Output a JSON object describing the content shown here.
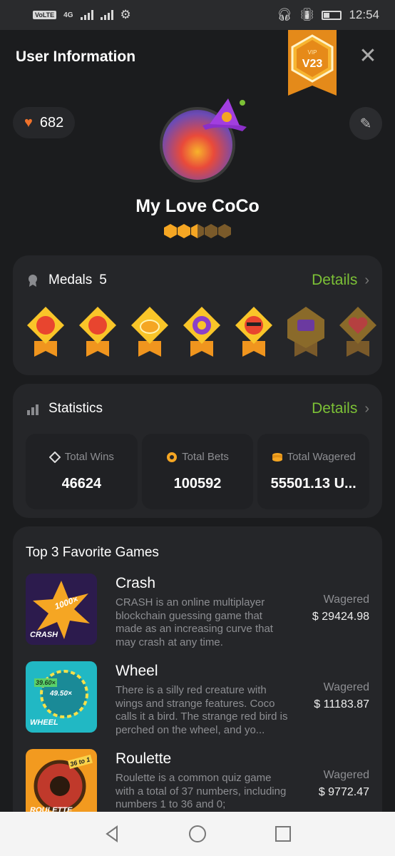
{
  "status_bar": {
    "time": "12:54",
    "volte": "VoLTE",
    "network": "4G"
  },
  "header": {
    "title": "User Information",
    "vip_label": "VIP",
    "vip_level": "V23"
  },
  "profile": {
    "likes": "682",
    "username": "My Love CoCo",
    "rank_filled": 2.5,
    "rank_total": 5
  },
  "medals": {
    "title": "Medals",
    "count": "5",
    "details_label": "Details",
    "items": [
      "medal-1",
      "medal-2",
      "medal-3",
      "medal-4",
      "medal-5",
      "medal-6-locked",
      "medal-7-locked"
    ]
  },
  "statistics": {
    "title": "Statistics",
    "details_label": "Details",
    "items": [
      {
        "label": "Total Wins",
        "value": "46624"
      },
      {
        "label": "Total Bets",
        "value": "100592"
      },
      {
        "label": "Total Wagered",
        "value": "55501.13 U..."
      }
    ]
  },
  "games": {
    "title": "Top 3 Favorite Games",
    "items": [
      {
        "name": "Crash",
        "thumb_tag": "CRASH",
        "thumb_badge": "1000×",
        "wager_label": "Wagered",
        "wager": "$ 29424.98",
        "desc": "CRASH is an online multiplayer blockchain guessing game that made as an increasing curve that may crash at any time."
      },
      {
        "name": "Wheel",
        "thumb_tag": "WHEEL",
        "thumb_badge": "49.50×",
        "thumb_badge2": "39.60×",
        "wager_label": "Wagered",
        "wager": "$ 11183.87",
        "desc": "There is a silly red creature with wings and strange features. Coco calls it a bird. The strange red bird is perched on the wheel, and yo..."
      },
      {
        "name": "Roulette",
        "thumb_tag": "ROULETTE",
        "thumb_badge": "36 to 1",
        "wager_label": "Wagered",
        "wager": "$ 9772.47",
        "desc": "Roulette is a common quiz game with a total of 37 numbers, including numbers 1 to 36 and 0;"
      }
    ]
  },
  "colors": {
    "accent_green": "#7cc136",
    "background": "#1b1c1e",
    "card": "#252629",
    "heart": "#f0722b",
    "gold": "#f5a623"
  }
}
